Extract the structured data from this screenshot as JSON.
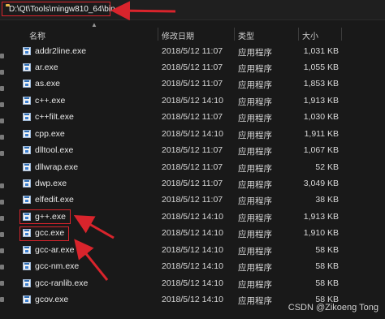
{
  "address_bar": {
    "path": "D:\\Qt\\Tools\\mingw810_64\\bin"
  },
  "columns": {
    "name": "名称",
    "date": "修改日期",
    "type": "类型",
    "size": "大小"
  },
  "files": [
    {
      "name": "addr2line.exe",
      "date": "2018/5/12 11:07",
      "type": "应用程序",
      "size": "1,031 KB"
    },
    {
      "name": "ar.exe",
      "date": "2018/5/12 11:07",
      "type": "应用程序",
      "size": "1,055 KB"
    },
    {
      "name": "as.exe",
      "date": "2018/5/12 11:07",
      "type": "应用程序",
      "size": "1,853 KB"
    },
    {
      "name": "c++.exe",
      "date": "2018/5/12 14:10",
      "type": "应用程序",
      "size": "1,913 KB"
    },
    {
      "name": "c++filt.exe",
      "date": "2018/5/12 11:07",
      "type": "应用程序",
      "size": "1,030 KB"
    },
    {
      "name": "cpp.exe",
      "date": "2018/5/12 14:10",
      "type": "应用程序",
      "size": "1,911 KB"
    },
    {
      "name": "dlltool.exe",
      "date": "2018/5/12 11:07",
      "type": "应用程序",
      "size": "1,067 KB"
    },
    {
      "name": "dllwrap.exe",
      "date": "2018/5/12 11:07",
      "type": "应用程序",
      "size": "52 KB"
    },
    {
      "name": "dwp.exe",
      "date": "2018/5/12 11:07",
      "type": "应用程序",
      "size": "3,049 KB"
    },
    {
      "name": "elfedit.exe",
      "date": "2018/5/12 11:07",
      "type": "应用程序",
      "size": "38 KB"
    },
    {
      "name": "g++.exe",
      "date": "2018/5/12 14:10",
      "type": "应用程序",
      "size": "1,913 KB"
    },
    {
      "name": "gcc.exe",
      "date": "2018/5/12 14:10",
      "type": "应用程序",
      "size": "1,910 KB"
    },
    {
      "name": "gcc-ar.exe",
      "date": "2018/5/12 14:10",
      "type": "应用程序",
      "size": "58 KB"
    },
    {
      "name": "gcc-nm.exe",
      "date": "2018/5/12 14:10",
      "type": "应用程序",
      "size": "58 KB"
    },
    {
      "name": "gcc-ranlib.exe",
      "date": "2018/5/12 14:10",
      "type": "应用程序",
      "size": "58 KB"
    },
    {
      "name": "gcov.exe",
      "date": "2018/5/12 14:10",
      "type": "应用程序",
      "size": "58 KB"
    }
  ],
  "watermark": "CSDN @Zikoeng Tong",
  "colors": {
    "annotation": "#d9242c",
    "background": "#191919",
    "folder": "#e8b84a"
  }
}
